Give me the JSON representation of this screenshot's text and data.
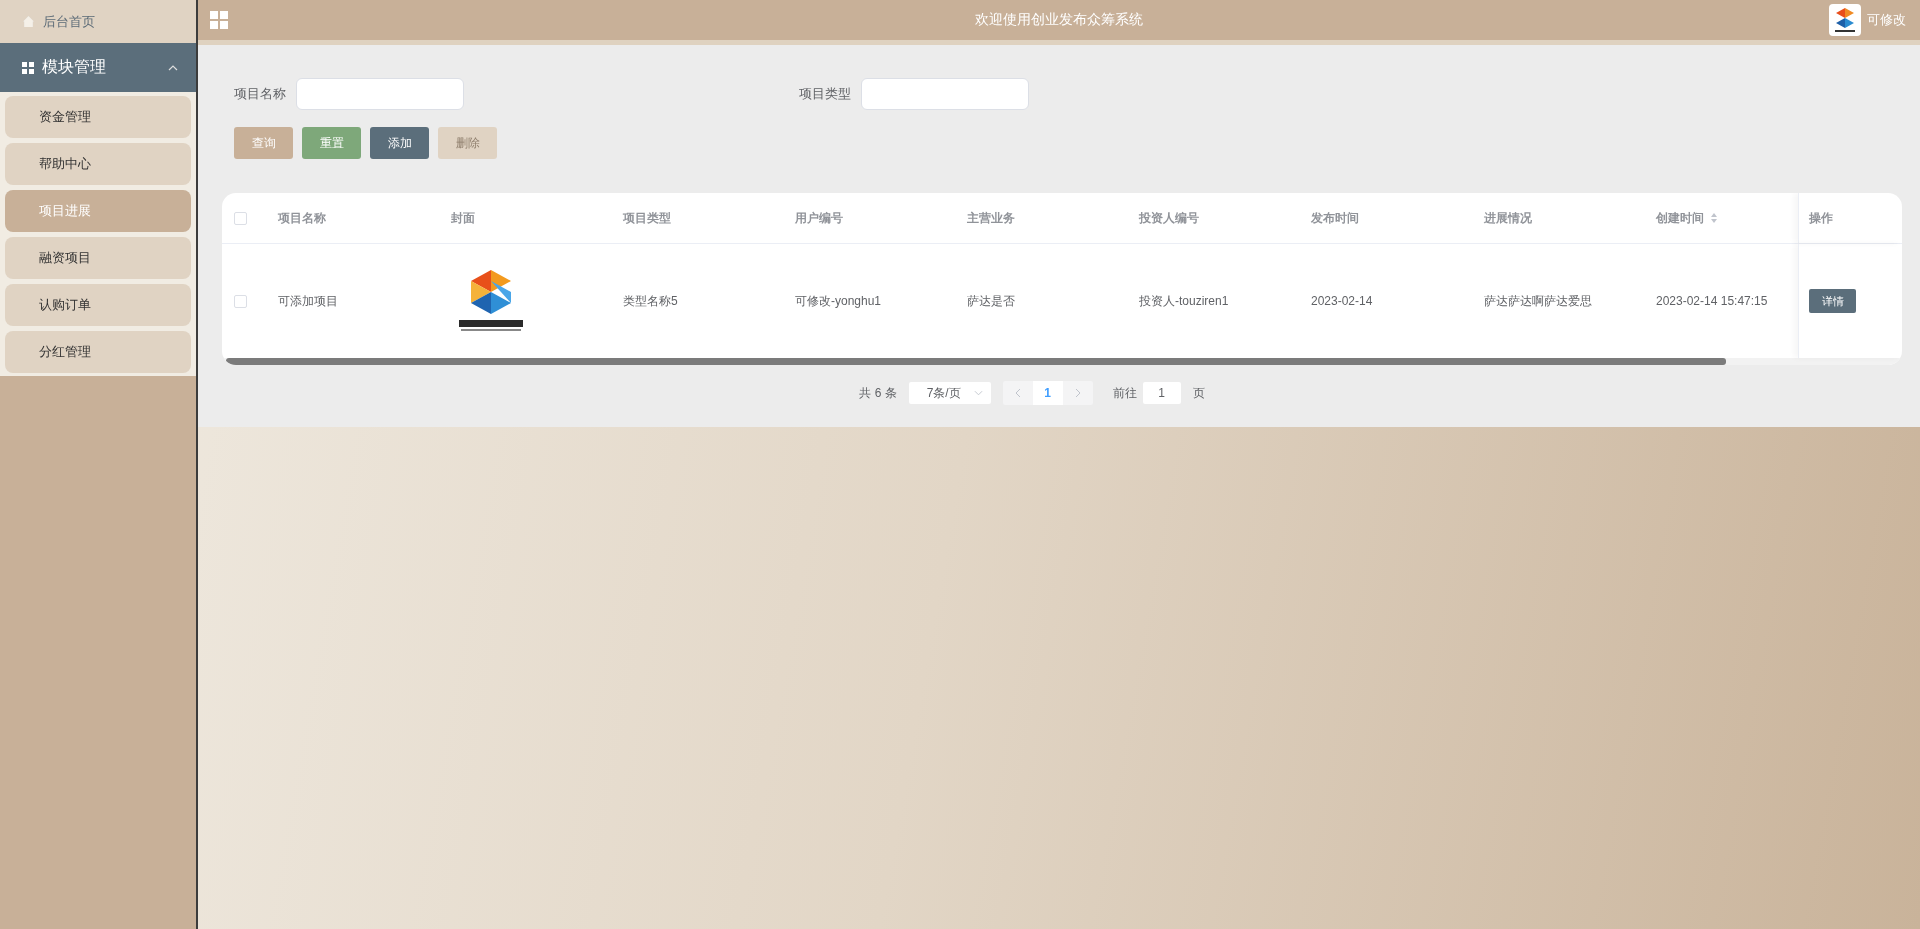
{
  "topbar": {
    "title": "欢迎使用创业发布众筹系统",
    "user": "可修改"
  },
  "sidebar": {
    "home": "后台首页",
    "group": {
      "label": "模块管理",
      "expanded": true
    },
    "items": [
      {
        "label": "资金管理",
        "selected": false
      },
      {
        "label": "帮助中心",
        "selected": false
      },
      {
        "label": "项目进展",
        "selected": true
      },
      {
        "label": "融资项目",
        "selected": false
      },
      {
        "label": "认购订单",
        "selected": false
      },
      {
        "label": "分红管理",
        "selected": false
      }
    ]
  },
  "filters": [
    {
      "label": "项目名称"
    },
    {
      "label": "项目类型"
    }
  ],
  "buttons": [
    {
      "label": "查询",
      "kind": "search",
      "disabled": false
    },
    {
      "label": "重置",
      "kind": "reset",
      "disabled": false
    },
    {
      "label": "添加",
      "kind": "add",
      "disabled": false
    },
    {
      "label": "删除",
      "kind": "delete",
      "disabled": true
    }
  ],
  "table": {
    "all_checked": false,
    "columns": [
      {
        "label": "项目名称",
        "sortable": false
      },
      {
        "label": "封面",
        "sortable": false
      },
      {
        "label": "项目类型",
        "sortable": false
      },
      {
        "label": "用户编号",
        "sortable": false
      },
      {
        "label": "主营业务",
        "sortable": false
      },
      {
        "label": "投资人编号",
        "sortable": false
      },
      {
        "label": "发布时间",
        "sortable": false
      },
      {
        "label": "进展情况",
        "sortable": false
      },
      {
        "label": "创建时间",
        "sortable": true
      },
      {
        "label": "操作",
        "sortable": false
      }
    ],
    "rows": [
      {
        "checked": false,
        "cells": [
          "可添加项目",
          {
            "kind": "picture"
          },
          "类型名称5",
          "可修改-yonghu1",
          "萨达是否",
          "投资人-touziren1",
          "2023-02-14",
          "萨达萨达啊萨达爱思",
          "2023-02-14 15:47:15"
        ],
        "action": "详情"
      }
    ]
  },
  "pagination": {
    "total": "共 6 条",
    "page_size": "7条/页",
    "pages": [
      {
        "label": "1",
        "selected": true
      }
    ],
    "jump_label": "前往",
    "jump_value": "1",
    "jump_suffix": "页"
  }
}
